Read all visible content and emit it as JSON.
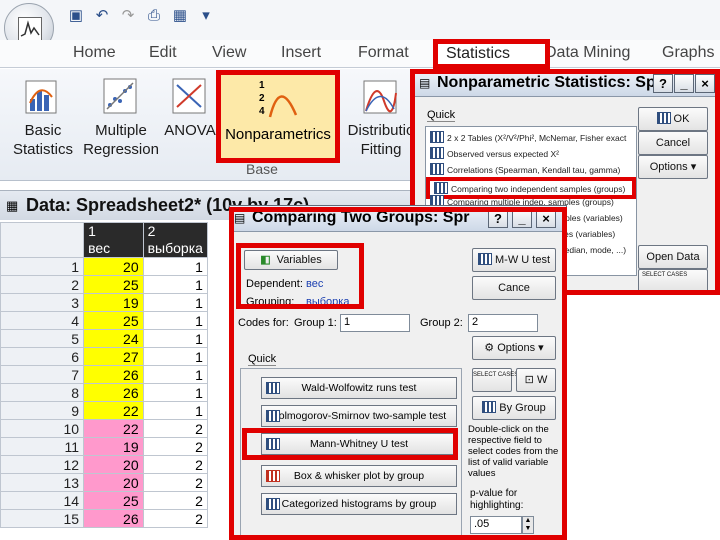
{
  "quick_access": {
    "icons": [
      "app-orb-icon",
      "save-icon",
      "undo-icon",
      "redo-icon",
      "print-icon",
      "data-editor-icon",
      "customize-icon"
    ]
  },
  "ribbon": {
    "tabs": [
      "Home",
      "Edit",
      "View",
      "Insert",
      "Format",
      "Statistics",
      "Data Mining",
      "Graphs"
    ],
    "active_tab": "Statistics",
    "buttons": [
      {
        "line1": "Basic",
        "line2": "Statistics"
      },
      {
        "line1": "Multiple",
        "line2": "Regression"
      },
      {
        "line1": "ANOVA",
        "line2": ""
      },
      {
        "line1": "Nonparametrics",
        "line2": ""
      },
      {
        "line1": "Distributio",
        "line2": "Fitting"
      }
    ],
    "group_label": "Base"
  },
  "spreadsheet": {
    "title": "Data: Spreadsheet2* (10v by 17c)",
    "columns": [
      {
        "num": "1",
        "name": "вес"
      },
      {
        "num": "2",
        "name": "выборка"
      }
    ],
    "rows": [
      {
        "n": "1",
        "v1": "20",
        "v2": "1"
      },
      {
        "n": "2",
        "v1": "25",
        "v2": "1"
      },
      {
        "n": "3",
        "v1": "19",
        "v2": "1"
      },
      {
        "n": "4",
        "v1": "25",
        "v2": "1"
      },
      {
        "n": "5",
        "v1": "24",
        "v2": "1"
      },
      {
        "n": "6",
        "v1": "27",
        "v2": "1"
      },
      {
        "n": "7",
        "v1": "26",
        "v2": "1"
      },
      {
        "n": "8",
        "v1": "26",
        "v2": "1"
      },
      {
        "n": "9",
        "v1": "22",
        "v2": "1"
      },
      {
        "n": "10",
        "v1": "22",
        "v2": "2"
      },
      {
        "n": "11",
        "v1": "19",
        "v2": "2"
      },
      {
        "n": "12",
        "v1": "20",
        "v2": "2"
      },
      {
        "n": "13",
        "v1": "20",
        "v2": "2"
      },
      {
        "n": "14",
        "v1": "25",
        "v2": "2"
      },
      {
        "n": "15",
        "v1": "26",
        "v2": "2"
      }
    ],
    "colors": {
      "group1": "#ffff00",
      "group2": "#ff99cc",
      "header": "#2a2a2a"
    }
  },
  "np_dialog": {
    "title": "Nonparametric Statistics: Sprea",
    "tab": "Quick",
    "items": [
      "2 x 2 Tables (X²/V²/Phi², McNemar, Fisher exact",
      "Observed versus expected X²",
      "Correlations (Spearman, Kendall tau, gamma)",
      "Comparing two independent samples (groups)",
      "Comparing multiple indep. samples (groups)",
      "Comparing two dependent samples (variables)",
      "Comparing multiple dep. samples (variables)",
      "Ordinal descriptive statistics (median, mode, ...)"
    ],
    "selected_index": 3,
    "buttons": {
      "ok": "OK",
      "cancel": "Cancel",
      "options": "Options",
      "open_data": "Open Data"
    },
    "select_cases": "SELECT CASES"
  },
  "cmp_dialog": {
    "title": "Comparing Two Groups: Spr",
    "variables_btn": "Variables",
    "dependent_label": "Dependent:",
    "dependent_value": "вес",
    "grouping_label": "Grouping:",
    "grouping_value": "выборка",
    "codes_label": "Codes for:",
    "group1_label": "Group 1:",
    "group1_value": "1",
    "group2_label": "Group 2:",
    "group2_value": "2",
    "tab": "Quick",
    "tests": [
      "Wald-Wolfowitz runs test",
      "Kolmogorov-Smirnov two-sample test",
      "Mann-Whitney U test",
      "Box & whisker plot by group",
      "Categorized histograms by group"
    ],
    "mwu_btn": "M-W U test",
    "cancel_btn": "Cance",
    "options_btn": "Options",
    "select_cases": "SELECT CASES",
    "by_group_btn": "By Group",
    "help_text": "Double-click on the respective field to select codes from the list of valid variable values",
    "pvalue_label": "p-value for highlighting:",
    "pvalue_value": ".05",
    "s_label": "S",
    "w_label": "W"
  }
}
